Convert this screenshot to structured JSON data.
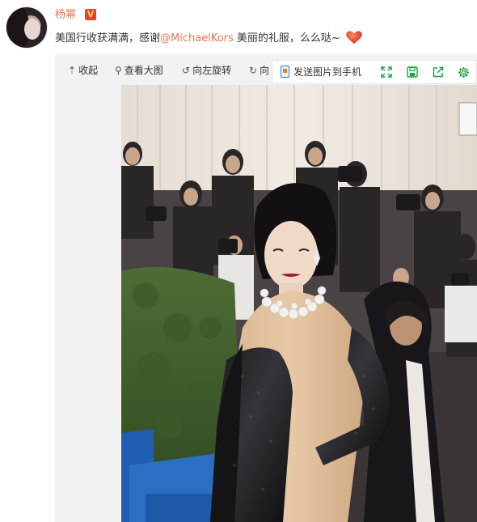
{
  "post": {
    "username": "杨幂",
    "badge": "V",
    "text_before": "美国行收获满满，感谢",
    "mention": "@MichaelKors",
    "text_after": " 美丽的礼服，么么哒~"
  },
  "toolbar": {
    "collapse": "收起",
    "view_large": "查看大图",
    "rotate_left": "向左旋转",
    "rotate_right": "向",
    "send_to_phone": "发送图片到手机"
  },
  "icons": {
    "collapse": "arrow-up-icon",
    "view_large": "magnifier-icon",
    "rotate_left": "rotate-left-icon",
    "rotate_right": "rotate-right-icon",
    "fullscreen": "expand-icon",
    "save": "save-icon",
    "share": "share-icon",
    "settings": "gear-icon"
  },
  "colors": {
    "link": "#eb7350",
    "action_green": "#17a23b",
    "text": "#333333",
    "verified_badge": "#e8402f"
  }
}
